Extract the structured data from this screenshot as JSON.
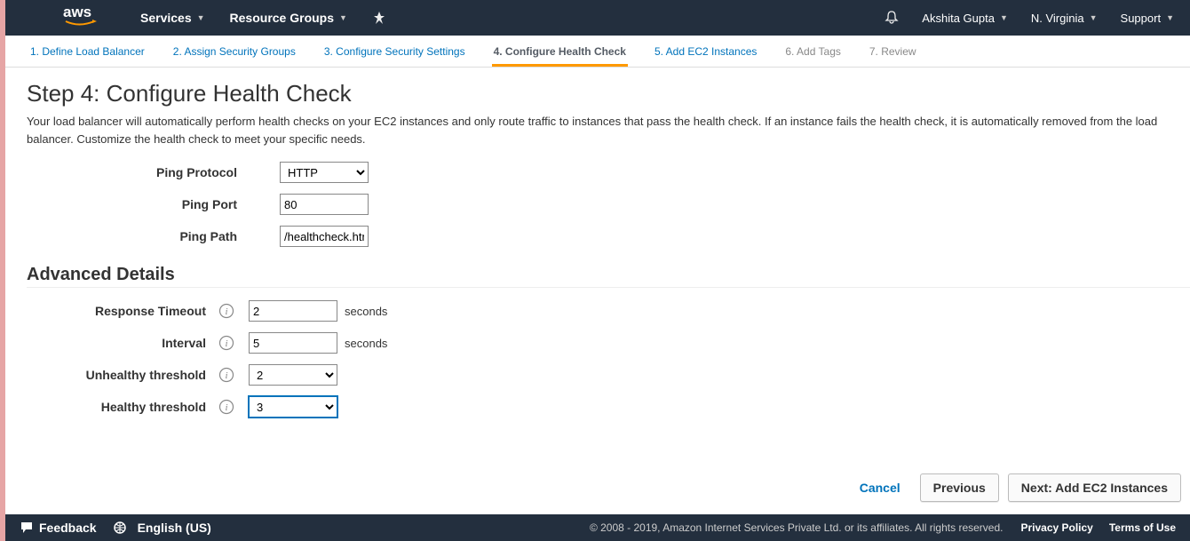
{
  "nav": {
    "services": "Services",
    "resource_groups": "Resource Groups",
    "user": "Akshita Gupta",
    "region": "N. Virginia",
    "support": "Support"
  },
  "wizard": {
    "steps": [
      {
        "label": "1. Define Load Balancer",
        "state": "link"
      },
      {
        "label": "2. Assign Security Groups",
        "state": "link"
      },
      {
        "label": "3. Configure Security Settings",
        "state": "link"
      },
      {
        "label": "4. Configure Health Check",
        "state": "active"
      },
      {
        "label": "5. Add EC2 Instances",
        "state": "link"
      },
      {
        "label": "6. Add Tags",
        "state": "disabled"
      },
      {
        "label": "7. Review",
        "state": "disabled"
      }
    ]
  },
  "page": {
    "title": "Step 4: Configure Health Check",
    "description": "Your load balancer will automatically perform health checks on your EC2 instances and only route traffic to instances that pass the health check. If an instance fails the health check, it is automatically removed from the load balancer. Customize the health check to meet your specific needs."
  },
  "form": {
    "ping_protocol_label": "Ping Protocol",
    "ping_protocol_value": "HTTP",
    "ping_port_label": "Ping Port",
    "ping_port_value": "80",
    "ping_path_label": "Ping Path",
    "ping_path_value": "/healthcheck.html"
  },
  "advanced": {
    "header": "Advanced Details",
    "response_timeout_label": "Response Timeout",
    "response_timeout_value": "2",
    "response_timeout_unit": "seconds",
    "interval_label": "Interval",
    "interval_value": "5",
    "interval_unit": "seconds",
    "unhealthy_label": "Unhealthy threshold",
    "unhealthy_value": "2",
    "healthy_label": "Healthy threshold",
    "healthy_value": "3"
  },
  "buttons": {
    "cancel": "Cancel",
    "previous": "Previous",
    "next": "Next: Add EC2 Instances"
  },
  "footer": {
    "feedback": "Feedback",
    "language": "English (US)",
    "copyright": "© 2008 - 2019, Amazon Internet Services Private Ltd. or its affiliates. All rights reserved.",
    "privacy": "Privacy Policy",
    "terms": "Terms of Use"
  }
}
